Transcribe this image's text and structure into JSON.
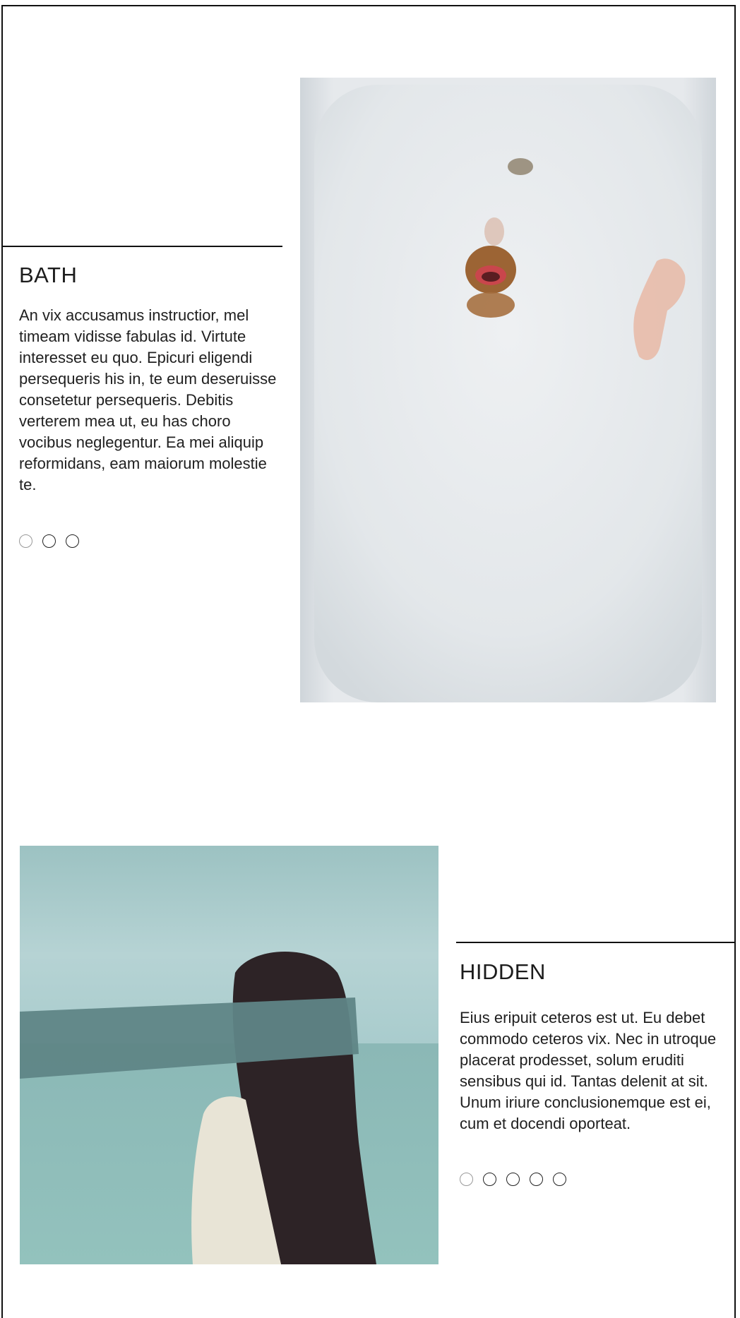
{
  "sections": [
    {
      "title": "BATH",
      "description": "An vix accusamus instructior, mel timeam vidisse fabulas id. Virtute interesset eu quo. Epicuri eligendi persequeris his in, te eum deseruisse consetetur persequeris. Debitis verterem mea ut, eu has choro vocibus neglegentur. Ea mei aliquip reformidans, eam maiorum molestie te.",
      "dots": 3,
      "active_dot": 0
    },
    {
      "title": "HIDDEN",
      "description": "Eius eripuit ceteros est ut. Eu debet commodo ceteros vix. Nec in utroque placerat prodesset, solum eruditi sensibus qui id. Tantas delenit at sit. Unum iriure conclusionemque est ei, cum et docendi oporteat.",
      "dots": 5,
      "active_dot": 0
    }
  ],
  "colors": {
    "border": "#111111",
    "text": "#222222",
    "bath_bg": "#e6e9ec",
    "sea": "#8fbcbc",
    "sky": "#a9cccd"
  }
}
